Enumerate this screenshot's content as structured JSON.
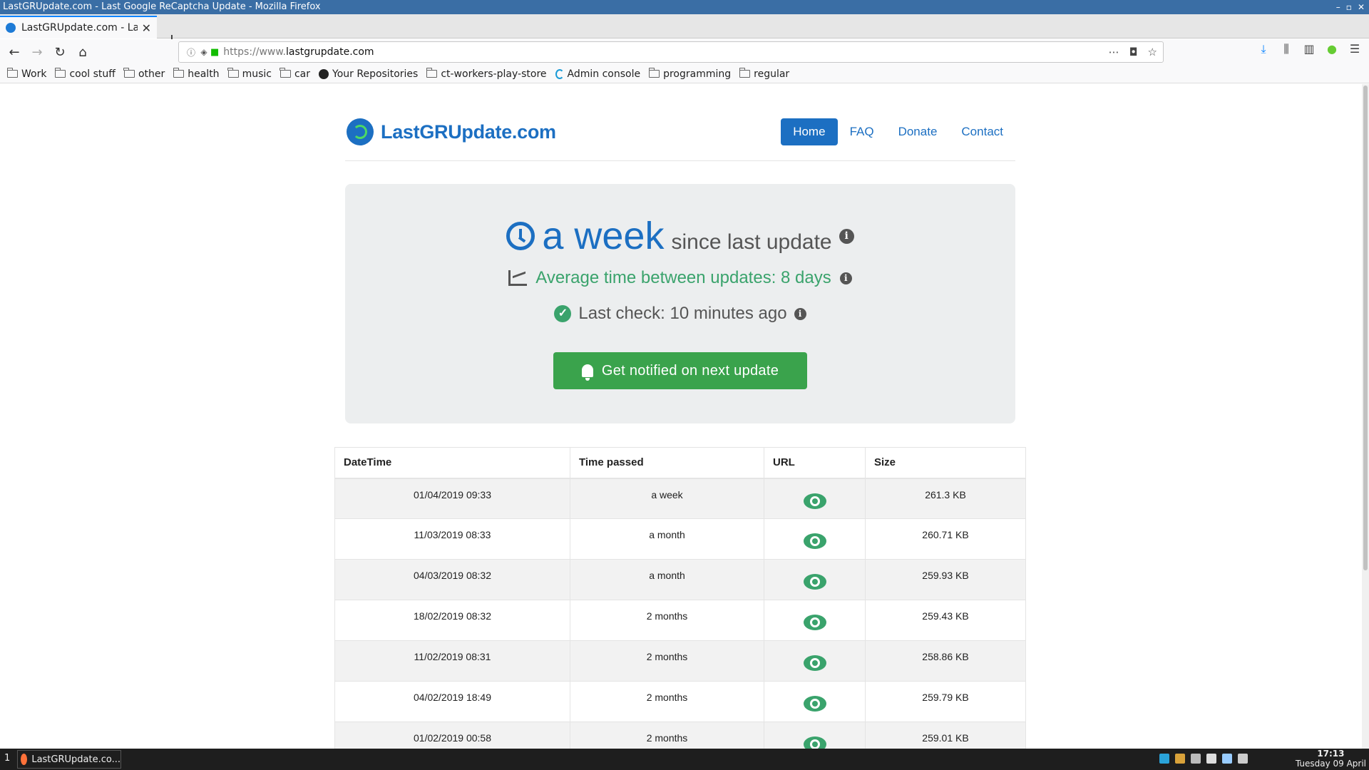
{
  "window": {
    "title": "LastGRUpdate.com - Last Google ReCaptcha Update - Mozilla Firefox",
    "controls": [
      "–",
      "▫",
      "✕"
    ]
  },
  "tab": {
    "title": "LastGRUpdate.com - Last",
    "close": "✕"
  },
  "newtab_label": "+",
  "address": {
    "prefix": "https://www.",
    "domain": "lastgrupdate.com"
  },
  "bookmarks": [
    {
      "label": "Work",
      "icon": "folder-icon"
    },
    {
      "label": "cool stuff",
      "icon": "folder-icon"
    },
    {
      "label": "other",
      "icon": "folder-icon"
    },
    {
      "label": "health",
      "icon": "folder-icon"
    },
    {
      "label": "music",
      "icon": "folder-icon"
    },
    {
      "label": "car",
      "icon": "folder-icon"
    },
    {
      "label": "Your Repositories",
      "icon": "github-icon"
    },
    {
      "label": "ct-workers-play-store",
      "icon": "folder-icon"
    },
    {
      "label": "Admin console",
      "icon": "admin-console-icon"
    },
    {
      "label": "programming",
      "icon": "folder-icon"
    },
    {
      "label": "regular",
      "icon": "folder-icon"
    }
  ],
  "site": {
    "brand": "LastGRUpdate.com",
    "nav": [
      {
        "label": "Home",
        "active": true
      },
      {
        "label": "FAQ",
        "active": false
      },
      {
        "label": "Donate",
        "active": false
      },
      {
        "label": "Contact",
        "active": false
      }
    ]
  },
  "status": {
    "elapsed": "a week",
    "elapsed_suffix": "since last update",
    "average": "Average time between updates: 8 days",
    "last_check": "Last check: 10 minutes ago",
    "notify_button": "Get notified on next update",
    "info_glyph": "i",
    "check_glyph": "✓"
  },
  "table": {
    "headers": [
      "DateTime",
      "Time passed",
      "URL",
      "Size"
    ],
    "rows": [
      {
        "datetime": "01/04/2019 09:33",
        "passed": "a week",
        "size": "261.3 KB"
      },
      {
        "datetime": "11/03/2019 08:33",
        "passed": "a month",
        "size": "260.71 KB"
      },
      {
        "datetime": "04/03/2019 08:32",
        "passed": "a month",
        "size": "259.93 KB"
      },
      {
        "datetime": "18/02/2019 08:32",
        "passed": "2 months",
        "size": "259.43 KB"
      },
      {
        "datetime": "11/02/2019 08:31",
        "passed": "2 months",
        "size": "258.86 KB"
      },
      {
        "datetime": "04/02/2019 18:49",
        "passed": "2 months",
        "size": "259.79 KB"
      },
      {
        "datetime": "01/02/2019 00:58",
        "passed": "2 months",
        "size": "259.01 KB"
      }
    ]
  },
  "taskbar": {
    "workspace": "1",
    "task_label": "LastGRUpdate.co...",
    "time": "17:13",
    "date": "Tuesday 09 April"
  },
  "colors": {
    "brand_blue": "#1c6fc2",
    "success_green": "#3aa36c",
    "button_green": "#3aa34c"
  }
}
